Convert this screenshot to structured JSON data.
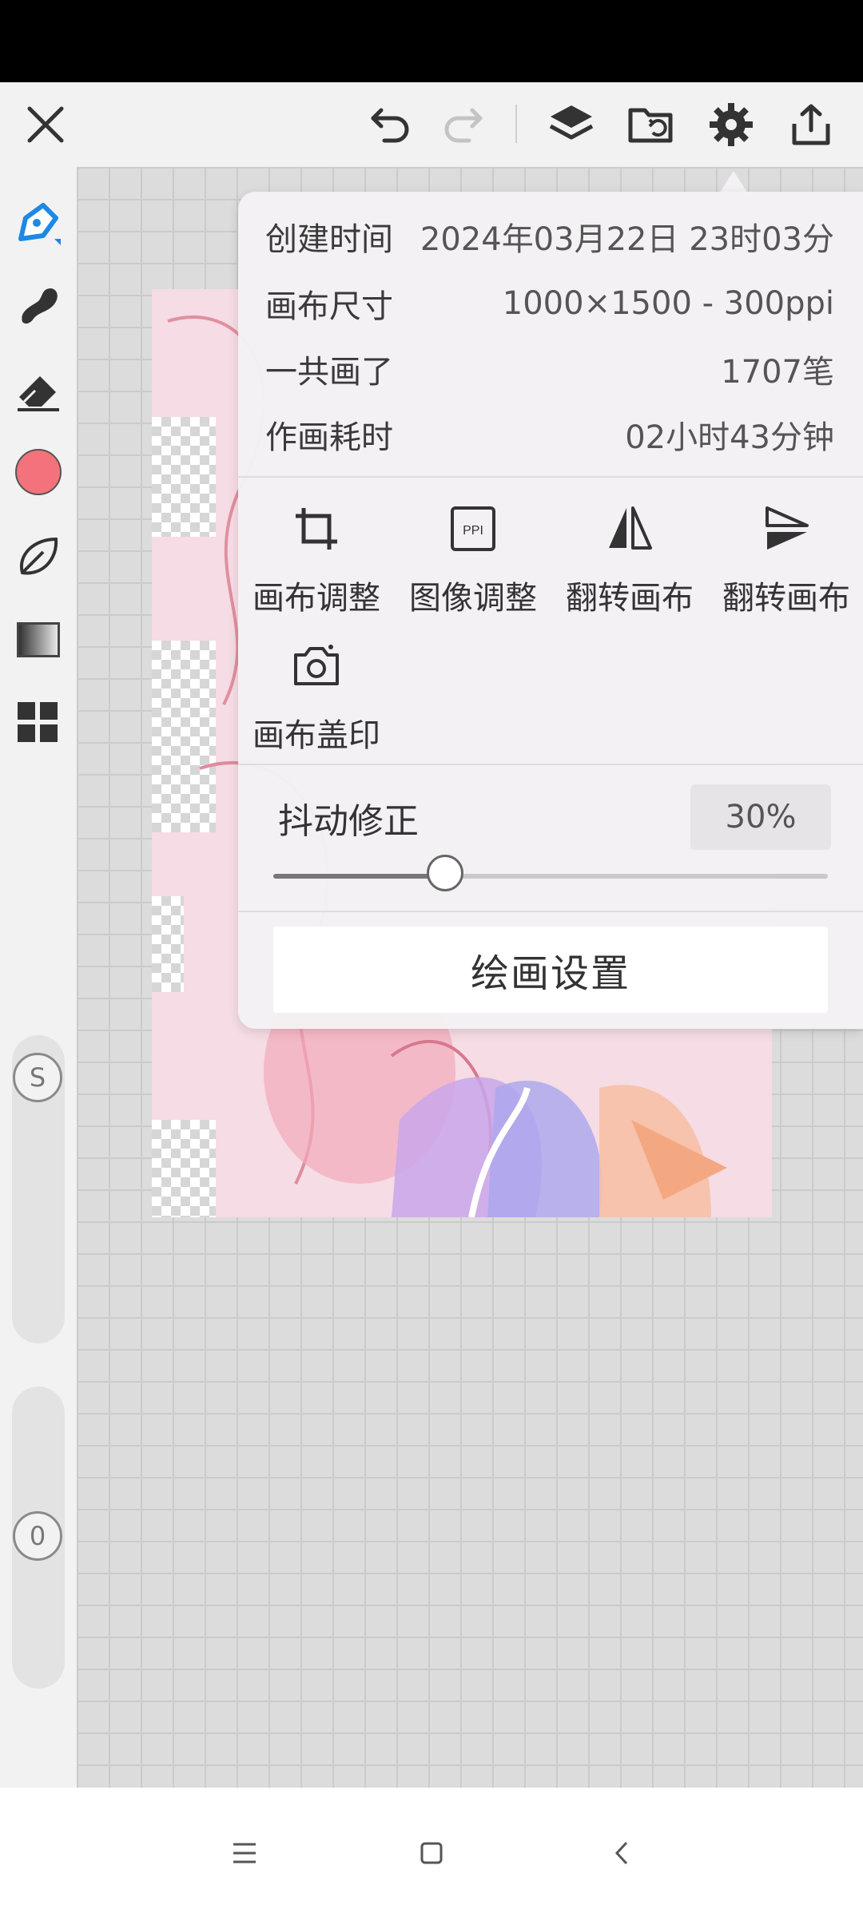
{
  "info": {
    "created_label": "创建时间",
    "created_value": "2024年03月22日 23时03分",
    "canvas_size_label": "画布尺寸",
    "canvas_size_value": "1000×1500 - 300ppi",
    "strokes_label": "一共画了",
    "strokes_value": "1707笔",
    "time_label": "作画耗时",
    "time_value": "02小时43分钟"
  },
  "actions": [
    {
      "label": "画布调整",
      "icon": "crop-icon"
    },
    {
      "label": "图像调整",
      "icon": "ppi-icon"
    },
    {
      "label": "翻转画布",
      "icon": "flip-horizontal-icon"
    },
    {
      "label": "翻转画布",
      "icon": "flip-vertical-icon"
    },
    {
      "label": "画布盖印",
      "icon": "camera-icon"
    }
  ],
  "stabilizer": {
    "label": "抖动修正",
    "value_text": "30%",
    "value": 0.31
  },
  "settings_button": "绘画设置",
  "left_toolbar": {
    "brush_size_badge": "S",
    "opacity_badge": "0",
    "current_color": "#f4727c"
  },
  "colors": {
    "accent": "#1e88e5",
    "status_bar": "#000000",
    "toolbar_bg": "#f2f2f2"
  }
}
